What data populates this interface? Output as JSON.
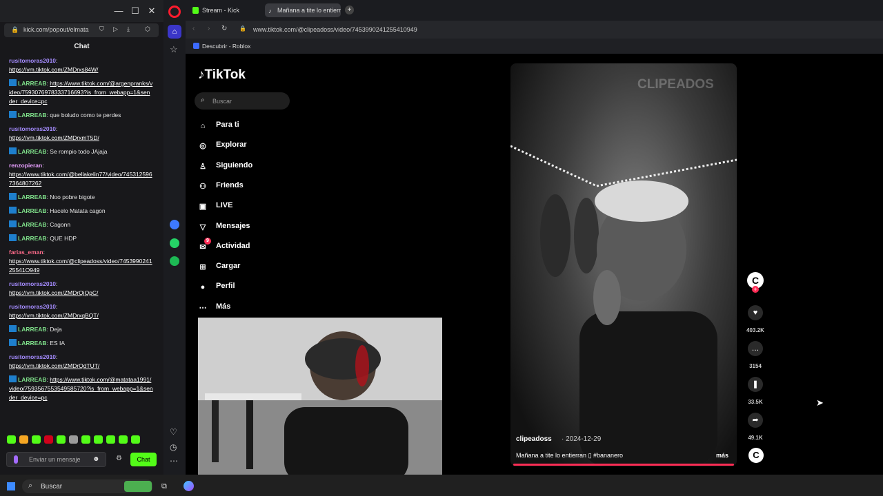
{
  "popup": {
    "url": "kick.com/popout/elmata",
    "chat_title": "Chat",
    "messages": [
      {
        "user": "rusitomoras2010",
        "text": "",
        "link": "https://vm.tiktok.com/ZMDrxs84W/",
        "color": "#a58cff",
        "badge": false
      },
      {
        "user": "LARREAB",
        "text": "",
        "link": "https://www.tiktok.com/@argenpranks/video/7593076978333716693?is_from_webapp=1&sender_device=pc",
        "color": "#7fe08a",
        "badge": true
      },
      {
        "user": "LARREAB",
        "text": "que boludo como te perdes",
        "link": "",
        "color": "#7fe08a",
        "badge": true
      },
      {
        "user": "rusitomoras2010",
        "text": "",
        "link": "https://vm.tiktok.com/ZMDrxmT5D/",
        "color": "#a58cff",
        "badge": false
      },
      {
        "user": "LARREAB",
        "text": "Se rompio todo JAjaja",
        "link": "",
        "color": "#7fe08a",
        "badge": true
      },
      {
        "user": "renzopieran",
        "text": "",
        "link": "https://www.tiktok.com/@bellakelin77/video/7453125967364807262",
        "color": "#e8a0ff",
        "badge": false
      },
      {
        "user": "LARREAB",
        "text": "Noo pobre bigote",
        "link": "",
        "color": "#7fe08a",
        "badge": true
      },
      {
        "user": "LARREAB",
        "text": "Hacelo Matata cagon",
        "link": "",
        "color": "#7fe08a",
        "badge": true
      },
      {
        "user": "LARREAB",
        "text": "Cagonn",
        "link": "",
        "color": "#7fe08a",
        "badge": true
      },
      {
        "user": "LARREAB",
        "text": "QUE HDP",
        "link": "",
        "color": "#7fe08a",
        "badge": true
      },
      {
        "user": "farias_eman",
        "text": "",
        "link": "https://www.tiktok.com/@clipeadoss/video/745399024125541O949",
        "color": "#ff6b8a",
        "badge": false
      },
      {
        "user": "rusitomoras2010",
        "text": "",
        "link": "https://vm.tiktok.com/ZMDrQjQpC/",
        "color": "#a58cff",
        "badge": false
      },
      {
        "user": "rusitomoras2010",
        "text": "",
        "link": "https://vm.tiktok.com/ZMDrxqBQT/",
        "color": "#a58cff",
        "badge": false
      },
      {
        "user": "LARREAB",
        "text": "Deja",
        "link": "",
        "color": "#7fe08a",
        "badge": true
      },
      {
        "user": "LARREAB",
        "text": "ES IA",
        "link": "",
        "color": "#7fe08a",
        "badge": true
      },
      {
        "user": "rusitomoras2010",
        "text": "",
        "link": "https://vm.tiktok.com/ZMDrQdTUT/",
        "color": "#a58cff",
        "badge": false
      },
      {
        "user": "LARREAB",
        "text": "",
        "link": "https://www.tiktok.com/@matataa1991/video/7593567553549585720?is_from_webapp=1&sender_device=pc",
        "color": "#7fe08a",
        "badge": true
      }
    ],
    "input_placeholder": "Enviar un mensaje",
    "send_label": "Chat"
  },
  "browser": {
    "tabs": [
      {
        "label": "Stream - Kick Dashboard",
        "active": false
      },
      {
        "label": "Mañana a tite lo entierra",
        "active": true
      }
    ],
    "url": "www.tiktok.com/@clipeadoss/video/7453990241255410949",
    "bookmark": "Descubrir - Roblox"
  },
  "tiktok": {
    "logo": "TikTok",
    "search_placeholder": "Buscar",
    "nav": [
      "Para ti",
      "Explorar",
      "Siguiendo",
      "Friends",
      "LIVE",
      "Mensajes",
      "Actividad",
      "Cargar",
      "Perfil",
      "Más"
    ],
    "nav_icons": [
      "home-icon",
      "compass-icon",
      "following-icon",
      "friends-icon",
      "live-icon",
      "messages-icon",
      "activity-icon",
      "upload-icon",
      "profile-icon",
      "more-icon"
    ],
    "activity_badge": "9",
    "video": {
      "watermark": "CLIPEADOS",
      "author": "clipeadoss",
      "date": "· 2024-12-29",
      "caption": "Mañana a tite lo entierran ▯ #bananero",
      "more": "más",
      "likes": "403.2K",
      "comments": "3154",
      "saves": "33.5K",
      "shares": "49.1K"
    }
  },
  "taskbar": {
    "search_placeholder": "Buscar"
  }
}
